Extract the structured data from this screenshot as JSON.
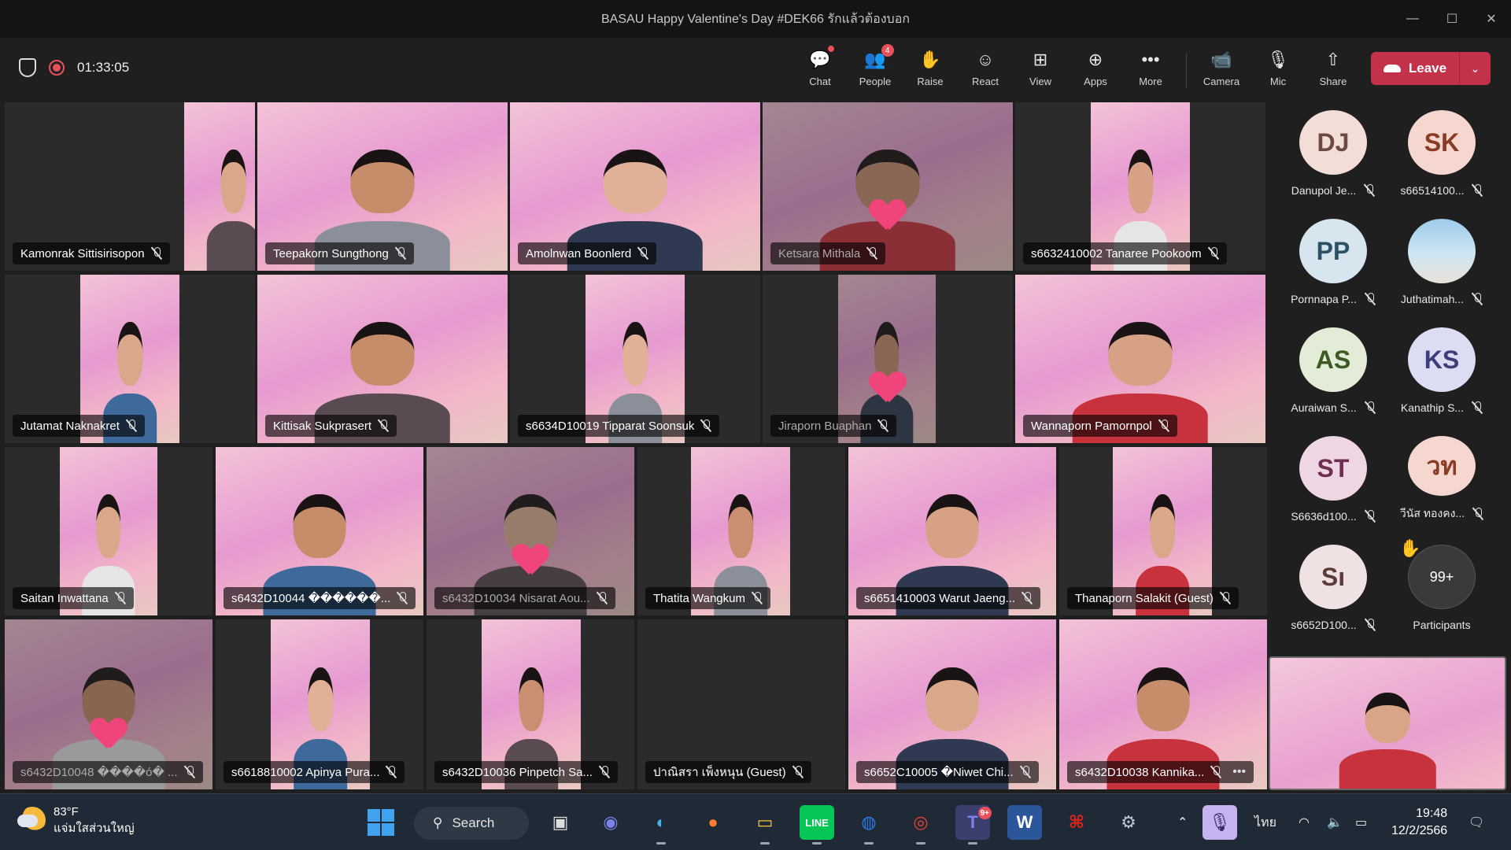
{
  "window": {
    "title": "BASAU Happy Valentine's Day #DEK66 รักแล้วต้องบอก",
    "minimize_icon": "—",
    "maximize_icon": "☐",
    "close_icon": "✕"
  },
  "meeting": {
    "timer": "01:33:05",
    "toolbar": {
      "chat": {
        "label": "Chat",
        "icon": "💬"
      },
      "people": {
        "label": "People",
        "icon": "👥",
        "badge": "4"
      },
      "raise": {
        "label": "Raise",
        "icon": "✋"
      },
      "react": {
        "label": "React",
        "icon": "☺"
      },
      "view": {
        "label": "View",
        "icon": "⊞"
      },
      "apps": {
        "label": "Apps",
        "icon": "⊕"
      },
      "more": {
        "label": "More",
        "icon": "•••"
      },
      "camera": {
        "label": "Camera",
        "icon": "📹"
      },
      "mic": {
        "label": "Mic",
        "icon": "🎙"
      },
      "share": {
        "label": "Share",
        "icon": "⇧"
      },
      "leave": {
        "label": "Leave",
        "chevron": "⌄"
      }
    }
  },
  "tiles": [
    {
      "name": "Kamonrak Sittisirisopon"
    },
    {
      "name": "Teepakorn Sungthong"
    },
    {
      "name": "Amolnwan Boonlerd"
    },
    {
      "name": "Ketsara Mithala"
    },
    {
      "name": "s6632410002 Tanaree Pookoom"
    },
    {
      "name": "Jutamat Naknakret"
    },
    {
      "name": "Kittisak Sukprasert"
    },
    {
      "name": "s6634D10019 Tipparat Soonsuk"
    },
    {
      "name": "Jiraporn Buaphan"
    },
    {
      "name": "Wannaporn Pamornpol"
    },
    {
      "name": "Saitan Inwattana"
    },
    {
      "name": "s6432D10044 ������..."
    },
    {
      "name": "s6432D10034 Nisarat Aou..."
    },
    {
      "name": "Thatita Wangkum"
    },
    {
      "name": "s6651410003 Warut Jaeng..."
    },
    {
      "name": "Thanaporn Salakit (Guest)"
    },
    {
      "name": "s6432D10048 ����ó� ..."
    },
    {
      "name": "s6618810002 Apinya Pura..."
    },
    {
      "name": "s6432D10036 Pinpetch Sa..."
    },
    {
      "name": "ปาณิสรา เพ็งหนุน (Guest)"
    },
    {
      "name": "s6652C10005 �Niwet Chi..."
    },
    {
      "name": "s6432D10038 Kannika..."
    }
  ],
  "participants": [
    {
      "initials": "DJ",
      "name": "Danupol Je...",
      "color": "#f2ddd7",
      "text": "#6b4a3f"
    },
    {
      "initials": "SK",
      "name": "s66514100...",
      "color": "#f6d7cf",
      "text": "#8a3b25"
    },
    {
      "initials": "PP",
      "name": "Pornnapa P...",
      "color": "#d7e6ee",
      "text": "#2c5266"
    },
    {
      "initials": "",
      "name": "Juthatimah...",
      "color": "#8bb8da",
      "text": "#fff"
    },
    {
      "initials": "AS",
      "name": "Auraiwan S...",
      "color": "#e2ecd6",
      "text": "#3e5a24"
    },
    {
      "initials": "KS",
      "name": "Kanathip S...",
      "color": "#dcdcf3",
      "text": "#3d3d7a"
    },
    {
      "initials": "ST",
      "name": "S6636d100...",
      "color": "#eed6e4",
      "text": "#6e2f55"
    },
    {
      "initials": "วท",
      "name": "วีนัส ทองคง...",
      "color": "#f6d7cf",
      "text": "#8a3b25"
    },
    {
      "initials": "Sı",
      "name": "s6652D100...",
      "color": "#f0e2e2",
      "text": "#5a3a3a"
    },
    {
      "initials": "99+",
      "name": "Participants",
      "color": "#3a3a3a",
      "text": "#fff"
    }
  ],
  "taskbar": {
    "weather_temp": "83°F",
    "weather_desc": "แจ่มใสส่วนใหญ่",
    "search_label": "Search",
    "teams_badge": "9+",
    "language": "ไทย",
    "time": "19:48",
    "date": "12/2/2566"
  }
}
